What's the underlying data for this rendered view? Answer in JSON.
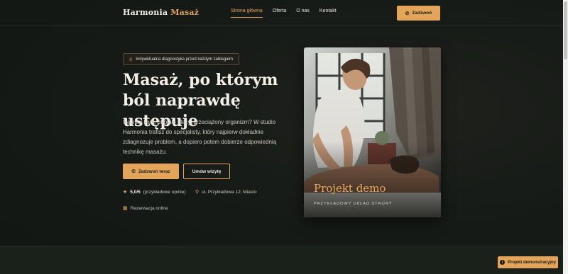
{
  "header": {
    "brand_main": "Harmonia",
    "brand_accent": "Masaż",
    "nav": [
      {
        "label": "Strona główna",
        "active": true
      },
      {
        "label": "Oferta",
        "active": false
      },
      {
        "label": "O nas",
        "active": false
      },
      {
        "label": "Kontakt",
        "active": false
      }
    ],
    "cta_label": "Zadzwoń"
  },
  "hero": {
    "badge": "Indywidualna diagnostyka przed każdym zabiegiem",
    "headline": "Masaż, po którym ból naprawdę ustępuje",
    "lead": "Napięty kark, obolałe plecy, przeciążony organizm? W studio Harmonia trafisz do specjalisty, który najpierw dokładnie zdiagnozuje problem, a dopiero potem dobierze odpowiednią technikę masażu.",
    "primary_button": "Zadzwoń teraz",
    "secondary_button": "Umów wizytę",
    "rating_value": "5,0/5",
    "rating_note": "(przykładowe opinie)",
    "address": "ul. Przykładowa 12, Miasto",
    "booking": "Rezerwacja online"
  },
  "card": {
    "title": "Projekt demo",
    "subtitle": "PRZYKŁADOWY UKŁAD STRONY"
  },
  "demo_badge": "Projekt demonstracyjny",
  "icons": {
    "phone": "phone-icon",
    "crown": "crown-icon",
    "star": "star-icon",
    "pin": "map-pin-icon",
    "calendar": "calendar-icon",
    "info": "info-icon"
  },
  "colors": {
    "accent": "#e2a55a",
    "background": "#121814"
  }
}
